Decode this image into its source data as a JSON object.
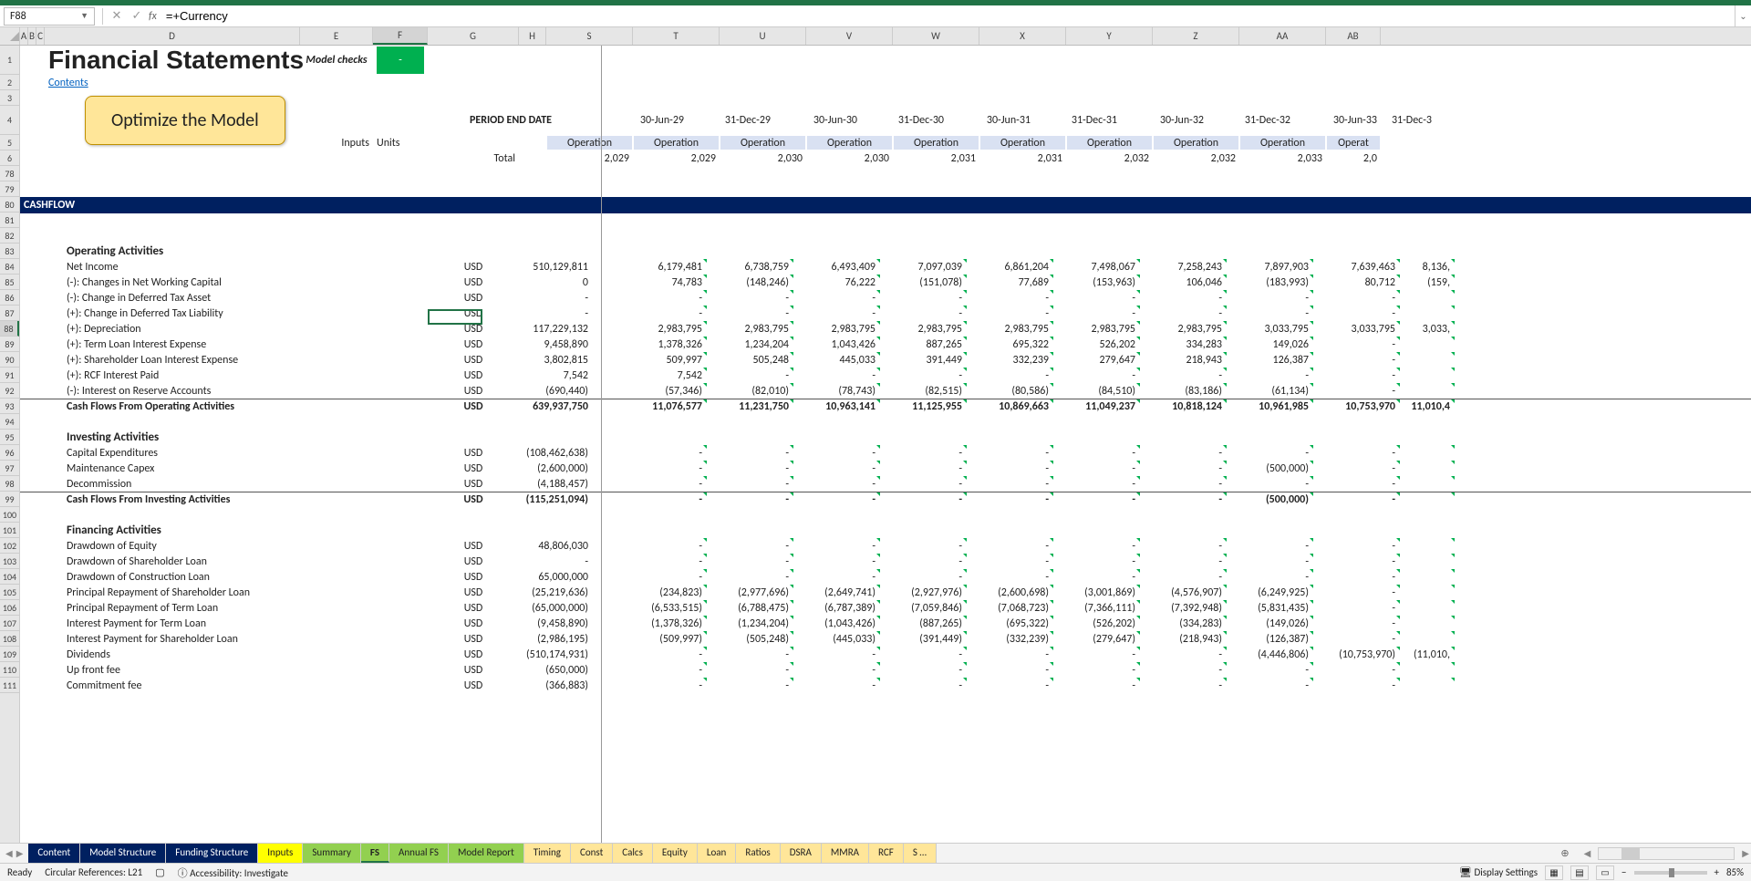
{
  "name_box": "F88",
  "formula": "=+Currency",
  "columns": [
    "A",
    "B",
    "C",
    "D",
    "E",
    "F",
    "G",
    "H",
    "S",
    "T",
    "U",
    "V",
    "W",
    "X",
    "Y",
    "Z",
    "AA",
    "AB"
  ],
  "selected_column": "F",
  "header": {
    "title": "Financial Statements",
    "model_checks": "Model checks",
    "green_dash": "-",
    "contents": "Contents",
    "optimize": "Optimize the Model",
    "period_end_date": "PERIOD END DATE",
    "inputs_label": "Inputs",
    "units_label": "Units",
    "total_label": "Total"
  },
  "dates": [
    "30-Jun-29",
    "31-Dec-29",
    "30-Jun-30",
    "31-Dec-30",
    "30-Jun-31",
    "31-Dec-31",
    "30-Jun-32",
    "31-Dec-32",
    "30-Jun-33",
    "31-Dec-3"
  ],
  "operation_label": "Operation",
  "op_short": "Operat",
  "years": [
    "2,029",
    "2,029",
    "2,030",
    "2,030",
    "2,031",
    "2,031",
    "2,032",
    "2,032",
    "2,033",
    "2,0"
  ],
  "cashflow_banner": "CASHFLOW",
  "sections": {
    "operating": "Operating Activities",
    "investing": "Investing Activities",
    "financing": "Financing Activities"
  },
  "rows": {
    "r84": {
      "label": "Net Income",
      "unit": "USD",
      "total": "510,129,811",
      "v": [
        "6,179,481",
        "6,738,759",
        "6,493,409",
        "7,097,039",
        "6,861,204",
        "7,498,067",
        "7,258,243",
        "7,897,903",
        "7,639,463",
        "8,136,"
      ]
    },
    "r85": {
      "label": "(-): Changes in Net Working Capital",
      "unit": "USD",
      "total": "0",
      "v": [
        "74,783",
        "(148,246)",
        "76,222",
        "(151,078)",
        "77,689",
        "(153,963)",
        "106,046",
        "(183,993)",
        "80,712",
        "(159,"
      ]
    },
    "r86": {
      "label": "(-): Change in Deferred Tax Asset",
      "unit": "USD",
      "total": "-",
      "v": [
        "-",
        "-",
        "-",
        "-",
        "-",
        "-",
        "-",
        "-",
        "-",
        ""
      ]
    },
    "r87": {
      "label": "(+): Change in Deferred Tax Liability",
      "unit": "USD",
      "total": "-",
      "v": [
        "-",
        "-",
        "-",
        "-",
        "-",
        "-",
        "-",
        "-",
        "-",
        ""
      ]
    },
    "r88": {
      "label": "(+): Depreciation",
      "unit": "USD",
      "total": "117,229,132",
      "v": [
        "2,983,795",
        "2,983,795",
        "2,983,795",
        "2,983,795",
        "2,983,795",
        "2,983,795",
        "2,983,795",
        "3,033,795",
        "3,033,795",
        "3,033,"
      ]
    },
    "r89": {
      "label": "(+): Term Loan Interest Expense",
      "unit": "USD",
      "total": "9,458,890",
      "v": [
        "1,378,326",
        "1,234,204",
        "1,043,426",
        "887,265",
        "695,322",
        "526,202",
        "334,283",
        "149,026",
        "-",
        ""
      ]
    },
    "r90": {
      "label": "(+): Shareholder Loan Interest Expense",
      "unit": "USD",
      "total": "3,802,815",
      "v": [
        "509,997",
        "505,248",
        "445,033",
        "391,449",
        "332,239",
        "279,647",
        "218,943",
        "126,387",
        "-",
        ""
      ]
    },
    "r91": {
      "label": "(+): RCF Interest Paid",
      "unit": "USD",
      "total": "7,542",
      "v": [
        "7,542",
        "-",
        "-",
        "-",
        "-",
        "-",
        "-",
        "-",
        "-",
        ""
      ]
    },
    "r92": {
      "label": "(-): Interest on Reserve Accounts",
      "unit": "USD",
      "total": "(690,440)",
      "v": [
        "(57,346)",
        "(82,010)",
        "(78,743)",
        "(82,515)",
        "(80,586)",
        "(84,510)",
        "(83,186)",
        "(61,134)",
        "-",
        ""
      ]
    },
    "r93": {
      "label": "Cash Flows From Operating Activities",
      "unit": "USD",
      "total": "639,937,750",
      "v": [
        "11,076,577",
        "11,231,750",
        "10,963,141",
        "11,125,955",
        "10,869,663",
        "11,049,237",
        "10,818,124",
        "10,961,985",
        "10,753,970",
        "11,010,4"
      ]
    },
    "r96": {
      "label": "Capital Expenditures",
      "unit": "USD",
      "total": "(108,462,638)",
      "v": [
        "-",
        "-",
        "-",
        "-",
        "-",
        "-",
        "-",
        "-",
        "-",
        ""
      ]
    },
    "r97": {
      "label": "Maintenance Capex",
      "unit": "USD",
      "total": "(2,600,000)",
      "v": [
        "-",
        "-",
        "-",
        "-",
        "-",
        "-",
        "-",
        "(500,000)",
        "-",
        ""
      ]
    },
    "r98": {
      "label": "Decommission",
      "unit": "USD",
      "total": "(4,188,457)",
      "v": [
        "-",
        "-",
        "-",
        "-",
        "-",
        "-",
        "-",
        "-",
        "-",
        ""
      ]
    },
    "r99": {
      "label": "Cash Flows From Investing Activities",
      "unit": "USD",
      "total": "(115,251,094)",
      "v": [
        "-",
        "-",
        "-",
        "-",
        "-",
        "-",
        "-",
        "(500,000)",
        "-",
        ""
      ]
    },
    "r102": {
      "label": "Drawdown of Equity",
      "unit": "USD",
      "total": "48,806,030",
      "v": [
        "-",
        "-",
        "-",
        "-",
        "-",
        "-",
        "-",
        "-",
        "-",
        ""
      ]
    },
    "r103": {
      "label": "Drawdown of Shareholder Loan",
      "unit": "USD",
      "total": "-",
      "v": [
        "-",
        "-",
        "-",
        "-",
        "-",
        "-",
        "-",
        "-",
        "-",
        ""
      ]
    },
    "r104": {
      "label": "Drawdown of Construction Loan",
      "unit": "USD",
      "total": "65,000,000",
      "v": [
        "-",
        "-",
        "-",
        "-",
        "-",
        "-",
        "-",
        "-",
        "-",
        ""
      ]
    },
    "r105": {
      "label": "Principal Repayment of Shareholder Loan",
      "unit": "USD",
      "total": "(25,219,636)",
      "v": [
        "(234,823)",
        "(2,977,696)",
        "(2,649,741)",
        "(2,927,976)",
        "(2,600,698)",
        "(3,001,869)",
        "(4,576,907)",
        "(6,249,925)",
        "-",
        ""
      ]
    },
    "r106": {
      "label": "Principal Repayment of Term Loan",
      "unit": "USD",
      "total": "(65,000,000)",
      "v": [
        "(6,533,515)",
        "(6,788,475)",
        "(6,787,389)",
        "(7,059,846)",
        "(7,068,723)",
        "(7,366,111)",
        "(7,392,948)",
        "(5,831,435)",
        "-",
        ""
      ]
    },
    "r107": {
      "label": "Interest Payment for Term Loan",
      "unit": "USD",
      "total": "(9,458,890)",
      "v": [
        "(1,378,326)",
        "(1,234,204)",
        "(1,043,426)",
        "(887,265)",
        "(695,322)",
        "(526,202)",
        "(334,283)",
        "(149,026)",
        "-",
        ""
      ]
    },
    "r108": {
      "label": "Interest Payment for Shareholder Loan",
      "unit": "USD",
      "total": "(2,986,195)",
      "v": [
        "(509,997)",
        "(505,248)",
        "(445,033)",
        "(391,449)",
        "(332,239)",
        "(279,647)",
        "(218,943)",
        "(126,387)",
        "-",
        ""
      ]
    },
    "r109": {
      "label": "Dividends",
      "unit": "USD",
      "total": "(510,174,931)",
      "v": [
        "-",
        "-",
        "-",
        "-",
        "-",
        "-",
        "-",
        "(4,446,806)",
        "(10,753,970)",
        "(11,010,"
      ]
    },
    "r110": {
      "label": "Up front fee",
      "unit": "USD",
      "total": "(650,000)",
      "v": [
        "-",
        "-",
        "-",
        "-",
        "-",
        "-",
        "-",
        "-",
        "-",
        ""
      ]
    },
    "r111": {
      "label": "Commitment fee",
      "unit": "USD",
      "total": "(366,883)",
      "v": [
        "-",
        "-",
        "-",
        "-",
        "-",
        "-",
        "-",
        "-",
        "-",
        ""
      ]
    }
  },
  "row_numbers": [
    "1",
    "2",
    "3",
    "4",
    "5",
    "6",
    "78",
    "79",
    "80",
    "81",
    "82",
    "83",
    "84",
    "85",
    "86",
    "87",
    "88",
    "89",
    "90",
    "91",
    "92",
    "93",
    "94",
    "95",
    "96",
    "97",
    "98",
    "99",
    "100",
    "101",
    "102",
    "103",
    "104",
    "105",
    "106",
    "107",
    "108",
    "109",
    "110",
    "111"
  ],
  "selected_row": "88",
  "tabs": [
    {
      "label": "Content",
      "style": "dark"
    },
    {
      "label": "Model Structure",
      "style": "dark"
    },
    {
      "label": "Funding Structure",
      "style": "dark"
    },
    {
      "label": "Inputs",
      "style": "yellow"
    },
    {
      "label": "Summary",
      "style": "green"
    },
    {
      "label": "FS",
      "style": "green-active"
    },
    {
      "label": "Annual FS",
      "style": "green"
    },
    {
      "label": "Model Report",
      "style": "green"
    },
    {
      "label": "Timing",
      "style": "beige"
    },
    {
      "label": "Const",
      "style": "beige"
    },
    {
      "label": "Calcs",
      "style": "beige"
    },
    {
      "label": "Equity",
      "style": "beige"
    },
    {
      "label": "Loan",
      "style": "beige"
    },
    {
      "label": "Ratios",
      "style": "beige"
    },
    {
      "label": "DSRA",
      "style": "beige"
    },
    {
      "label": "MMRA",
      "style": "beige"
    },
    {
      "label": "RCF",
      "style": "beige"
    },
    {
      "label": "S …",
      "style": "beige"
    }
  ],
  "status": {
    "ready": "Ready",
    "circular": "Circular References: L21",
    "accessibility": "Accessibility: Investigate",
    "display_settings": "Display Settings",
    "zoom": "85%"
  }
}
